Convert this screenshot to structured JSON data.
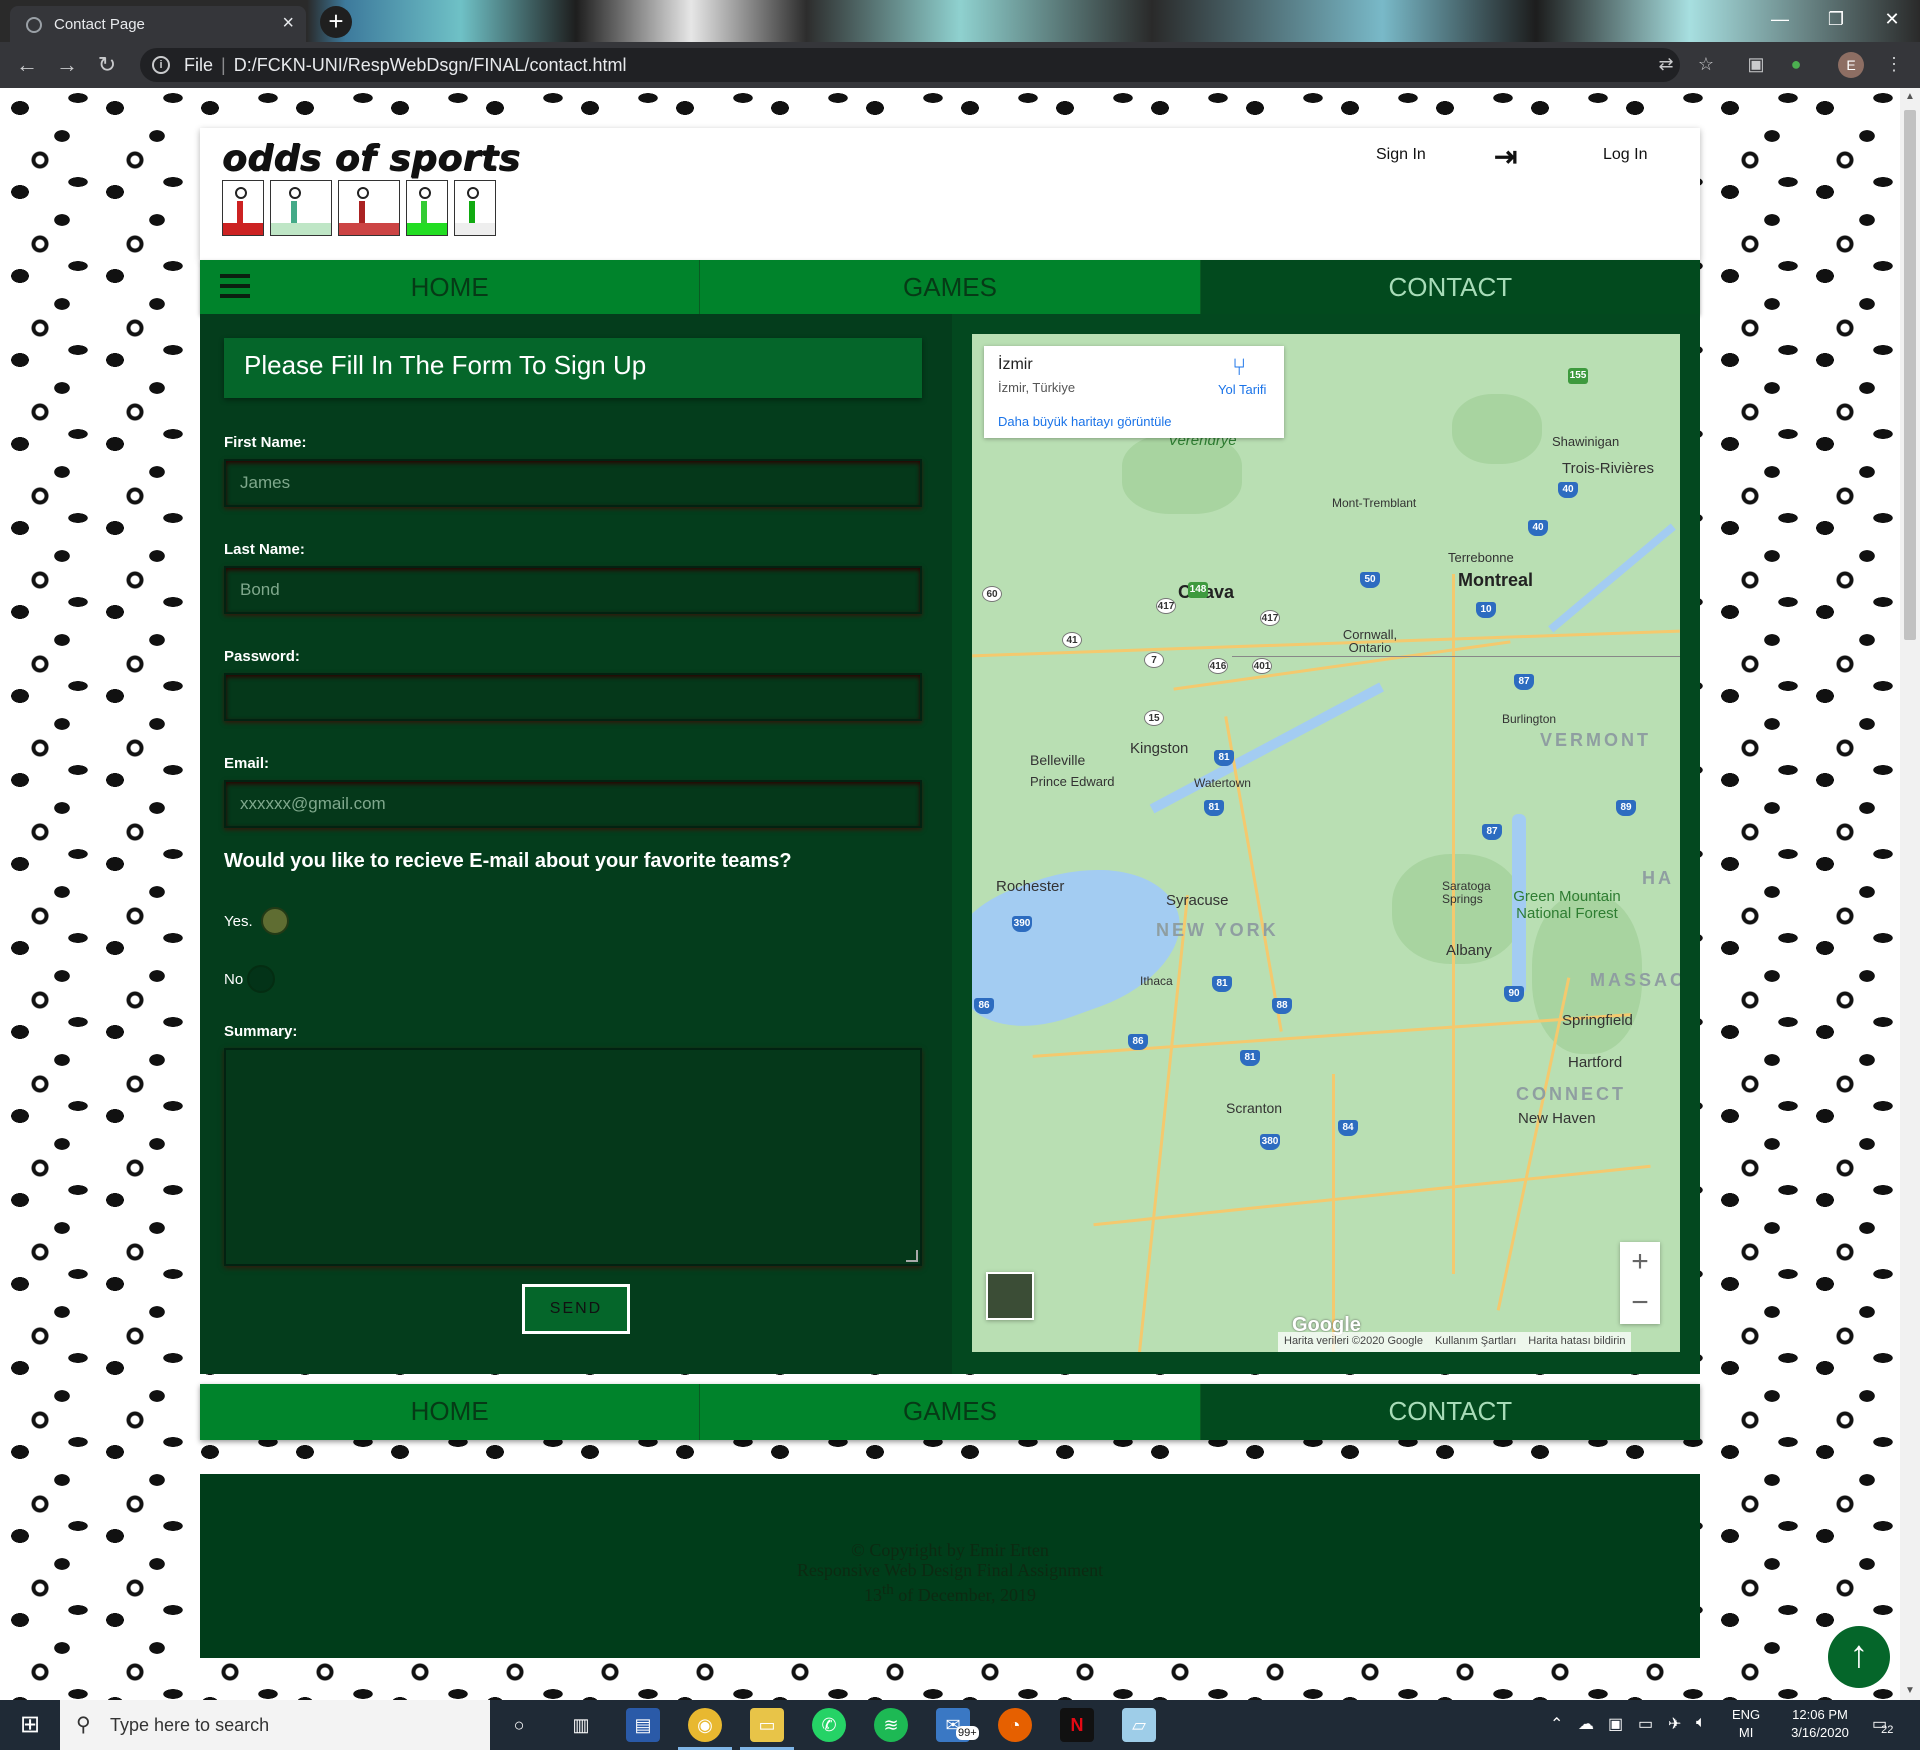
{
  "browser": {
    "tab_title": "Contact Page",
    "tab_close": "×",
    "new_tab": "+",
    "url_scheme": "File",
    "url": "D:/FCKN-UNI/RespWebDsgn/FINAL/contact.html",
    "profile_initial": "E"
  },
  "site": {
    "logo_text": "odds of sports",
    "sign_in": "Sign In",
    "log_in": "Log In",
    "nav": [
      "HOME",
      "GAMES",
      "CONTACT"
    ]
  },
  "form": {
    "title": "Please Fill In The Form To Sign Up",
    "first_name_label": "First Name:",
    "first_name_placeholder": "James",
    "last_name_label": "Last Name:",
    "last_name_placeholder": "Bond",
    "password_label": "Password:",
    "email_label": "Email:",
    "email_placeholder": "xxxxxx@gmail.com",
    "question": "Would you like to recieve E-mail about your favorite teams?",
    "yes_label": "Yes.",
    "no_label": "No",
    "summary_label": "Summary:",
    "send_label": "SEND"
  },
  "map": {
    "place_name": "İzmir",
    "place_sub": "İzmir, Türkiye",
    "directions": "Yol Tarifi",
    "larger_map": "Daha büyük haritayı görüntüle",
    "zoom_in": "+",
    "zoom_out": "−",
    "google": "Google",
    "footer": [
      "Harita verileri ©2020 Google",
      "Kullanım Şartları",
      "Harita hatası bildirin"
    ],
    "cities": [
      "Ottava",
      "Montreal",
      "Kingston",
      "Rochester",
      "Syracuse",
      "Albany",
      "Springfield",
      "Burlington",
      "Trois-Rivières",
      "Shawinigan",
      "Terrebonne",
      "Cornwall, Ontario",
      "Belleville",
      "Prince Edward",
      "Watertown",
      "Ithaca",
      "Scranton",
      "New Haven",
      "Hartford",
      "Saratoga Springs",
      "Mont-Tremblant",
      "Green Mountain National Forest",
      "Verendrye"
    ],
    "regions": [
      "NEW YORK",
      "VERMONT",
      "MASSAC",
      "CONNECT",
      "HA"
    ]
  },
  "footer": {
    "line1": "© Copyright by Emir Erten",
    "line2": "Responsive Web Design Final Assignment",
    "line3_pre": "13",
    "line3_sup": "th",
    "line3_post": " of December, 2019"
  },
  "taskbar": {
    "search_placeholder": "Type here to search",
    "mail_badge": "99+",
    "lang_top": "ENG",
    "lang_bottom": "MI",
    "time": "12:06 PM",
    "date": "3/16/2020",
    "notif_count": "22"
  },
  "colors": {
    "nav_green": "#00832b",
    "active_nav": "#024a1e",
    "panel_dark": "#043d1c"
  }
}
